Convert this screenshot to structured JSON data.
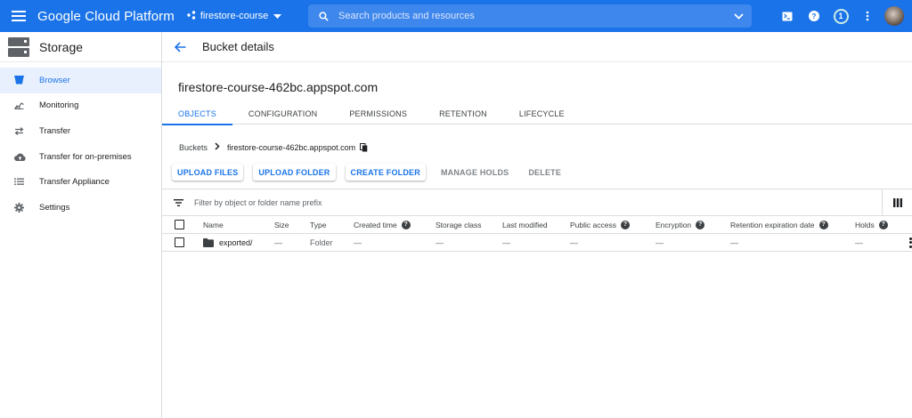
{
  "app": {
    "brand": "Google Cloud Platform",
    "project": "firestore-course",
    "search_placeholder": "Search products and resources",
    "notification_count": "1"
  },
  "sidebar": {
    "title": "Storage",
    "items": [
      {
        "label": "Browser",
        "icon": "bucket-icon",
        "active": true
      },
      {
        "label": "Monitoring",
        "icon": "monitoring-icon"
      },
      {
        "label": "Transfer",
        "icon": "transfer-icon"
      },
      {
        "label": "Transfer for on-premises",
        "icon": "cloud-upload-icon"
      },
      {
        "label": "Transfer Appliance",
        "icon": "list-icon"
      },
      {
        "label": "Settings",
        "icon": "gear-icon"
      }
    ]
  },
  "main": {
    "header_title": "Bucket details",
    "bucket_name": "firestore-course-462bc.appspot.com",
    "tabs": [
      "OBJECTS",
      "CONFIGURATION",
      "PERMISSIONS",
      "RETENTION",
      "LIFECYCLE"
    ],
    "active_tab": "OBJECTS",
    "breadcrumb": {
      "root": "Buckets",
      "current": "firestore-course-462bc.appspot.com"
    },
    "actions": {
      "upload_files": "UPLOAD FILES",
      "upload_folder": "UPLOAD FOLDER",
      "create_folder": "CREATE FOLDER",
      "manage_holds": "MANAGE HOLDS",
      "delete": "DELETE"
    },
    "filter_placeholder": "Filter by object or folder name prefix",
    "table": {
      "columns": {
        "name": "Name",
        "size": "Size",
        "type": "Type",
        "created": "Created time",
        "storage_class": "Storage class",
        "last_modified": "Last modified",
        "public_access": "Public access",
        "encryption": "Encryption",
        "retention": "Retention expiration date",
        "holds": "Holds"
      },
      "rows": [
        {
          "name": "exported/",
          "size": "—",
          "type": "Folder",
          "created": "—",
          "storage_class": "—",
          "last_modified": "—",
          "public_access": "—",
          "encryption": "—",
          "retention": "—",
          "holds": "—"
        }
      ]
    }
  }
}
